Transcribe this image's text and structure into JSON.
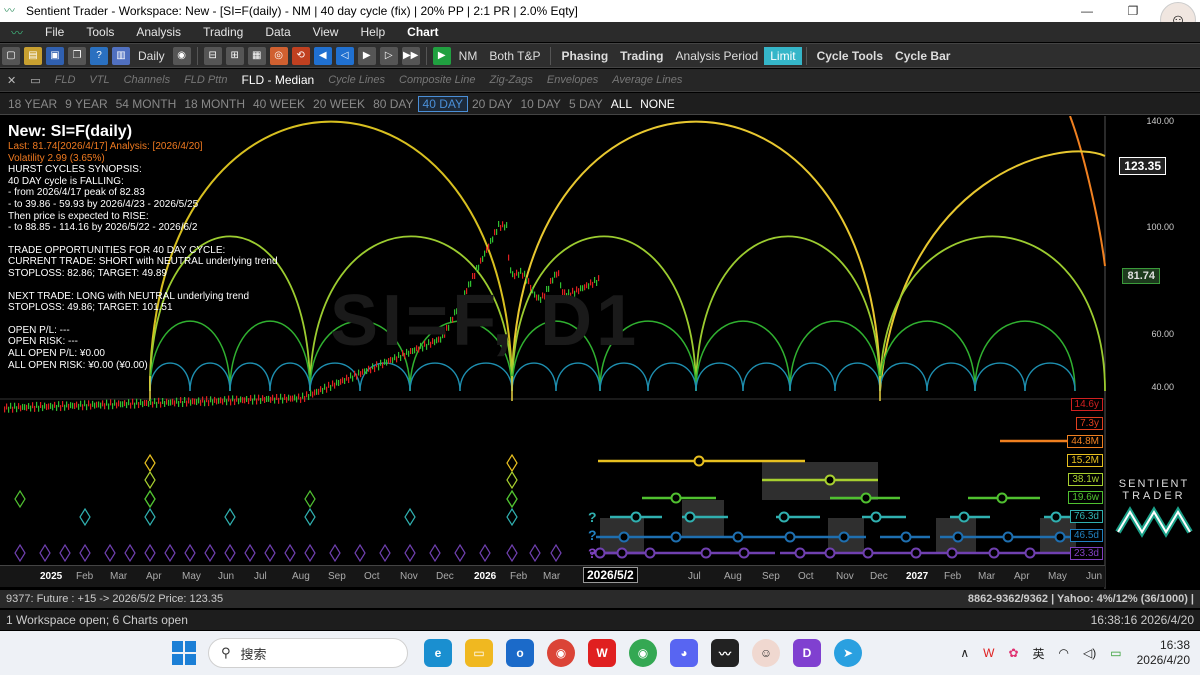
{
  "window": {
    "title": "Sentient Trader - Workspace: New - [SI=F(daily) - NM | 40 day cycle (fix) | 20% PP | 2:1 PR | 2.0% Eqty]",
    "minimize": "—",
    "restore": "❐",
    "close": "✕"
  },
  "menu": [
    "File",
    "Tools",
    "Analysis",
    "Trading",
    "Data",
    "View",
    "Help",
    "Chart"
  ],
  "toolbar": {
    "timeframe": "Daily",
    "nm": "NM",
    "both_tp": "Both T&P",
    "phasing": "Phasing",
    "trading": "Trading",
    "analysis_period": "Analysis Period",
    "limit": "Limit",
    "cycle_tools": "Cycle Tools",
    "cycle_bar": "Cycle Bar"
  },
  "toolbar2": [
    "FLD",
    "VTL",
    "Channels",
    "FLD Pttn",
    "FLD - Median",
    "Cycle Lines",
    "Composite Line",
    "Zig-Zags",
    "Envelopes",
    "Average Lines"
  ],
  "ranges": [
    "18 YEAR",
    "9 YEAR",
    "54 MONTH",
    "18 MONTH",
    "40 WEEK",
    "20 WEEK",
    "80 DAY",
    "40 DAY",
    "20 DAY",
    "10 DAY",
    "5 DAY",
    "ALL",
    "NONE"
  ],
  "synopsis": {
    "title": "New: SI=F(daily)",
    "last": "Last: 81.74[2026/4/17] Analysis: [2026/4/20]",
    "volatility": "Volatility 2.99 (3.65%)",
    "lines1": [
      "HURST CYCLES SYNOPSIS:",
      "40 DAY cycle is FALLING:",
      "- from 2026/4/17 peak of 82.83",
      "- to 39.86 - 59.93 by 2026/4/23 - 2026/5/25",
      "Then price is expected to RISE:",
      "- to 88.85 - 114.16 by 2026/5/22 - 2026/6/2"
    ],
    "lines2": [
      "TRADE OPPORTUNITIES FOR 40 DAY CYCLE:",
      "CURRENT TRADE: SHORT with NEUTRAL underlying trend",
      "STOPLOSS: 82.86; TARGET: 49.89"
    ],
    "lines3": [
      "NEXT TRADE: LONG with NEUTRAL underlying trend",
      "STOPLOSS: 49.86; TARGET: 101.51"
    ],
    "lines4": [
      "OPEN P/L: ---",
      "OPEN RISK: ---",
      "ALL OPEN P/L: ¥0.00",
      "ALL OPEN RISK: ¥0.00 (¥0.00)"
    ]
  },
  "watermark": "SI=F, D1",
  "price_axis": [
    "140.00",
    "100.00",
    "60.00",
    "40.00"
  ],
  "price_boxes": {
    "high": "123.35",
    "last": "81.74"
  },
  "cycle_labels": [
    {
      "text": "14.6y",
      "color": "#d02020"
    },
    {
      "text": "7.3y",
      "color": "#e04020"
    },
    {
      "text": "44.8M",
      "color": "#f08020"
    },
    {
      "text": "15.2M",
      "color": "#e8c020"
    },
    {
      "text": "38.1w",
      "color": "#a8d030"
    },
    {
      "text": "19.6w",
      "color": "#50c030"
    },
    {
      "text": "76.3d",
      "color": "#30b0b0"
    },
    {
      "text": "46.5d",
      "color": "#2080c0"
    },
    {
      "text": "23.3d",
      "color": "#8040c0"
    }
  ],
  "date_axis": {
    "ticks": [
      "2025",
      "Feb",
      "Mar",
      "Apr",
      "May",
      "Jun",
      "Jul",
      "Aug",
      "Sep",
      "Oct",
      "Nov",
      "Dec",
      "2026",
      "Feb",
      "Mar",
      "Jul",
      "Aug",
      "Sep",
      "Oct",
      "Nov",
      "Dec",
      "2027",
      "Feb",
      "Mar",
      "Apr",
      "May",
      "Jun"
    ],
    "cursor": "2026/5/2"
  },
  "logo": {
    "line1": "SENTIENT",
    "line2": "TRADER"
  },
  "status1": {
    "left": "9377: Future : +15 -> 2026/5/2 Price: 123.35",
    "right": "8862-9362/9362  | Yahoo: 4%/12% (36/1000) |"
  },
  "status2": {
    "left": "1 Workspace open; 6 Charts open",
    "right": "16:38:16  2026/4/20"
  },
  "taskbar": {
    "search": "搜索",
    "ime": "英",
    "time": "16:38",
    "date": "2026/4/20"
  }
}
